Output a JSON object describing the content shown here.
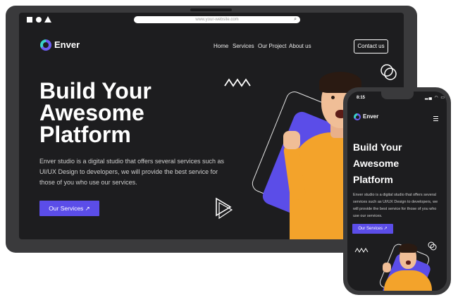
{
  "desktop": {
    "url": "www.your-website.com",
    "brand": "Enver",
    "nav": [
      "Home",
      "Services",
      "Our Project",
      "About us"
    ],
    "contact_label": "Contact us",
    "hero_title": "Build Your Awesome Platform",
    "hero_body": "Enver studio is a digital studio that offers several services such as UI/UX Design to developers, we will provide the best service for those of you who use our services.",
    "cta_label": "Our Services ↗"
  },
  "phone": {
    "time": "8:15",
    "status_icons": "▂▄ ◠ ▭",
    "brand": "Enver",
    "hero_title": "Build Your Awesome Platform",
    "hero_body": "Enver studio is a digital studio that offers several services such as UI/UX Design to developers, we will provide the best service for those of you who use our services.",
    "cta_label": "Our Services ↗"
  },
  "colors": {
    "accent": "#5b4de8",
    "background": "#1d1d1f",
    "frame": "#3a3a3c",
    "sweater": "#f3a32b"
  },
  "icons": {
    "window_controls": [
      "square-icon",
      "circle-icon",
      "triangle-icon"
    ],
    "search": "search-icon",
    "menu": "hamburger-menu-icon"
  }
}
